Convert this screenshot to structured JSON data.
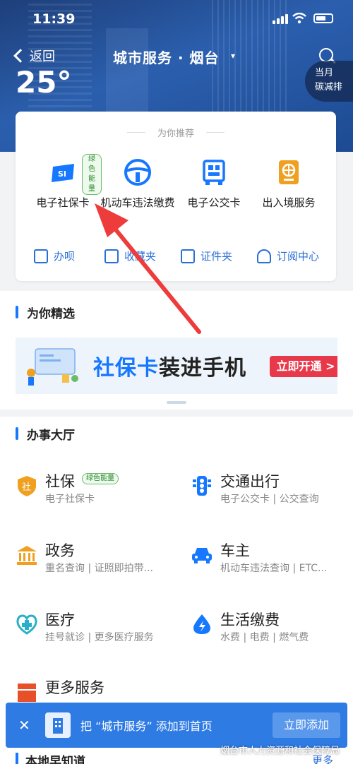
{
  "status_bar": {
    "time": "11:39"
  },
  "nav": {
    "back_label": "返回",
    "title": "城市服务 · 烟台",
    "title_caret": "▾"
  },
  "weather": {
    "temperature": "25°"
  },
  "carbon": {
    "line1": "当月",
    "line2": "碳减排"
  },
  "recommend": {
    "title": "为你推荐",
    "items": [
      {
        "label": "电子社保卡",
        "tag": "绿色能量",
        "icon": "social-security-card-icon"
      },
      {
        "label": "机动车违法缴费",
        "icon": "steering-wheel-icon"
      },
      {
        "label": "电子公交卡",
        "icon": "bus-qr-icon"
      },
      {
        "label": "出入境服务",
        "icon": "passport-icon"
      }
    ],
    "tools": [
      {
        "label": "办呗",
        "icon": "calendar-icon"
      },
      {
        "label": "收藏夹",
        "icon": "folder-icon"
      },
      {
        "label": "证件夹",
        "icon": "id-card-icon"
      },
      {
        "label": "订阅中心",
        "icon": "bell-icon"
      }
    ]
  },
  "featured": {
    "title": "为你精选",
    "banner": {
      "text_hl": "社保卡",
      "text_rest": "装进手机",
      "cta": "立即开通 >"
    }
  },
  "hall": {
    "title": "办事大厅",
    "items": [
      {
        "name": "社保",
        "tag": "绿色能量",
        "sub": "电子社保卡",
        "icon": "shield-icon",
        "color": "#f0a020"
      },
      {
        "name": "交通出行",
        "sub": "电子公交卡 | 公交查询",
        "icon": "traffic-light-icon",
        "color": "#1677ff"
      },
      {
        "name": "政务",
        "sub": "重名查询 | 证照即拍带...",
        "icon": "government-building-icon",
        "color": "#f0a020"
      },
      {
        "name": "车主",
        "sub": "机动车违法查询 | ETC...",
        "icon": "car-icon",
        "color": "#1677ff"
      },
      {
        "name": "医疗",
        "sub": "挂号就诊 | 更多医疗服务",
        "icon": "medical-cross-icon",
        "color": "#29b0c8"
      },
      {
        "name": "生活缴费",
        "sub": "水费 | 电费 | 燃气费",
        "icon": "water-drop-icon",
        "color": "#1677ff"
      },
      {
        "name": "更多服务",
        "sub": "",
        "icon": "more-services-icon",
        "color": "#e8502a"
      }
    ]
  },
  "toast": {
    "close": "✕",
    "message": "把 “城市服务” 添加到首页",
    "button": "立即添加"
  },
  "local": {
    "title": "本地早知道",
    "more": "更多"
  },
  "watermark": "烟台市人力资源和社会保障局",
  "colors": {
    "primary": "#1677ff",
    "arrow": "#ee3b3b",
    "toast": "#2f7be4"
  }
}
